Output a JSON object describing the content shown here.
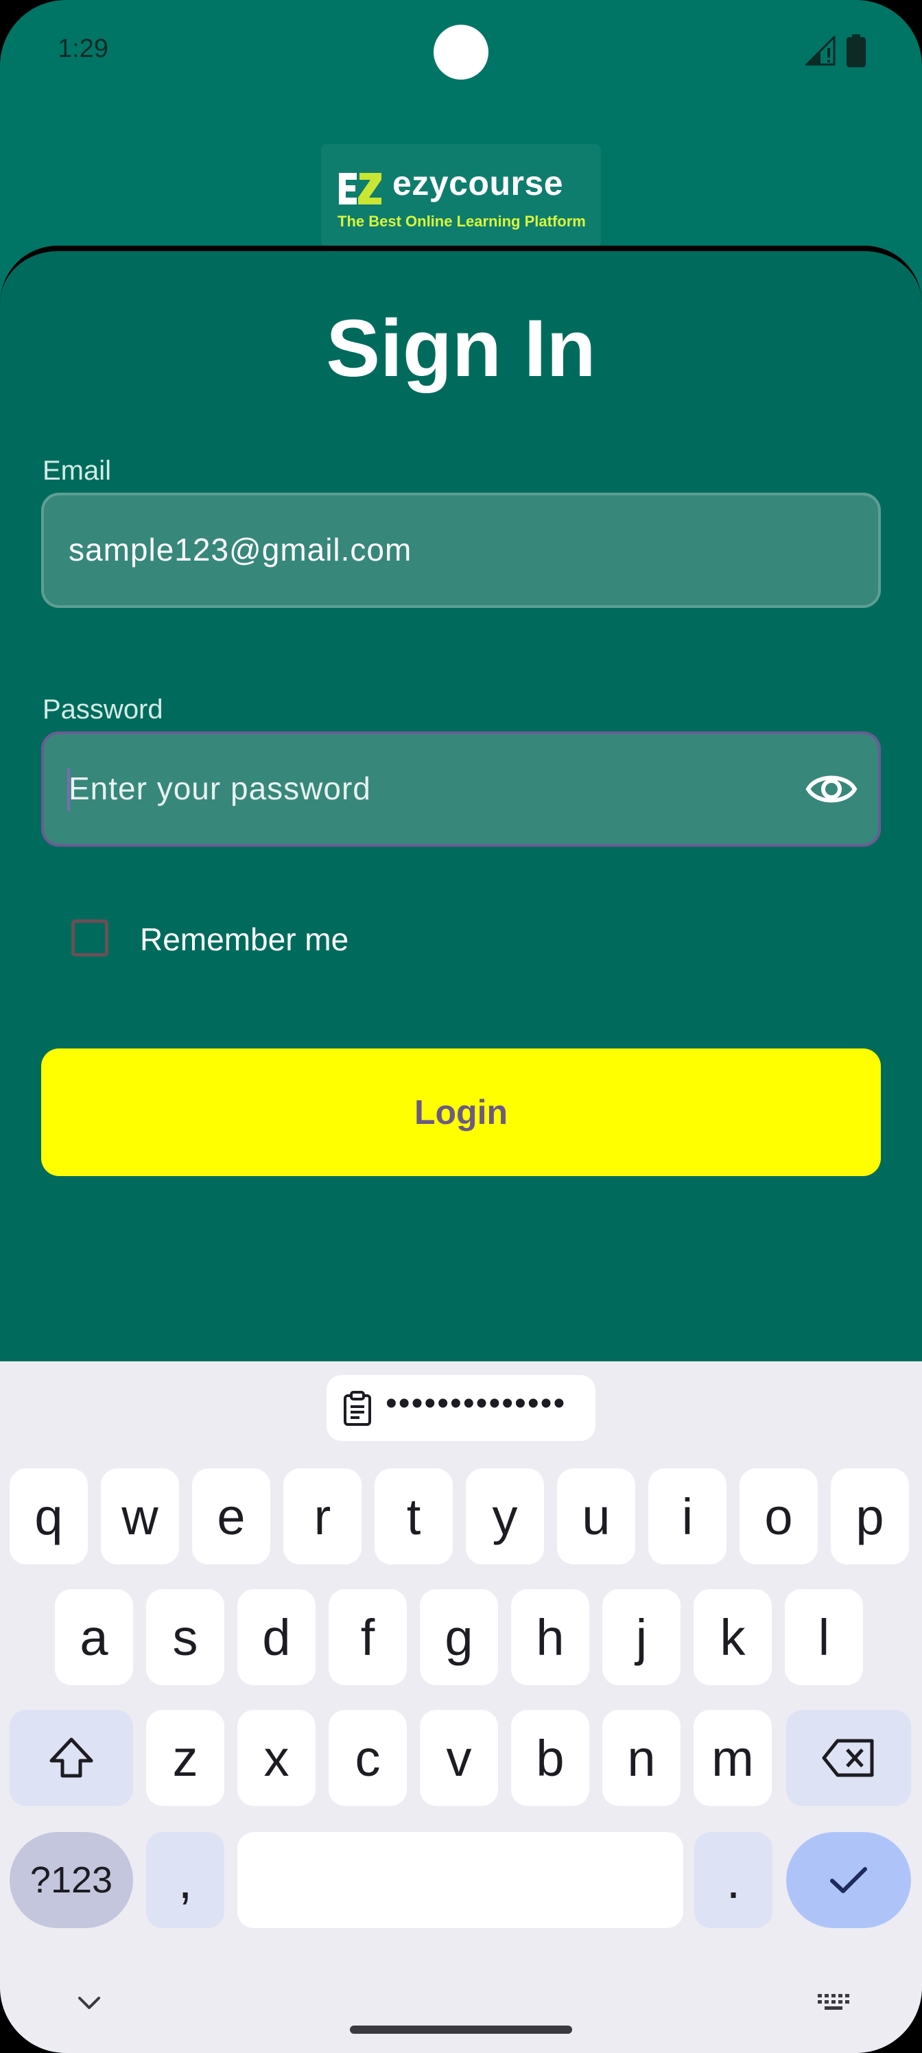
{
  "status_bar": {
    "time": "1:29"
  },
  "logo": {
    "name": "ezycourse",
    "tagline": "The Best Online Learning Platform"
  },
  "sign_in": {
    "title": "Sign In",
    "email_label": "Email",
    "email_value": "sample123@gmail.com",
    "password_label": "Password",
    "password_placeholder": "Enter your password",
    "remember_label": "Remember me",
    "login_label": "Login"
  },
  "keyboard": {
    "clipboard_preview": "••••••••••••••",
    "row1": [
      "q",
      "w",
      "e",
      "r",
      "t",
      "y",
      "u",
      "i",
      "o",
      "p"
    ],
    "row2": [
      "a",
      "s",
      "d",
      "f",
      "g",
      "h",
      "j",
      "k",
      "l"
    ],
    "row3": [
      "z",
      "x",
      "c",
      "v",
      "b",
      "n",
      "m"
    ],
    "symbols_label": "?123",
    "comma": ",",
    "period": "."
  },
  "colors": {
    "background": "#007565",
    "sheet": "#006b5c",
    "field": "#38877b",
    "login_button": "#ffff00",
    "login_text": "#6b5a85"
  }
}
